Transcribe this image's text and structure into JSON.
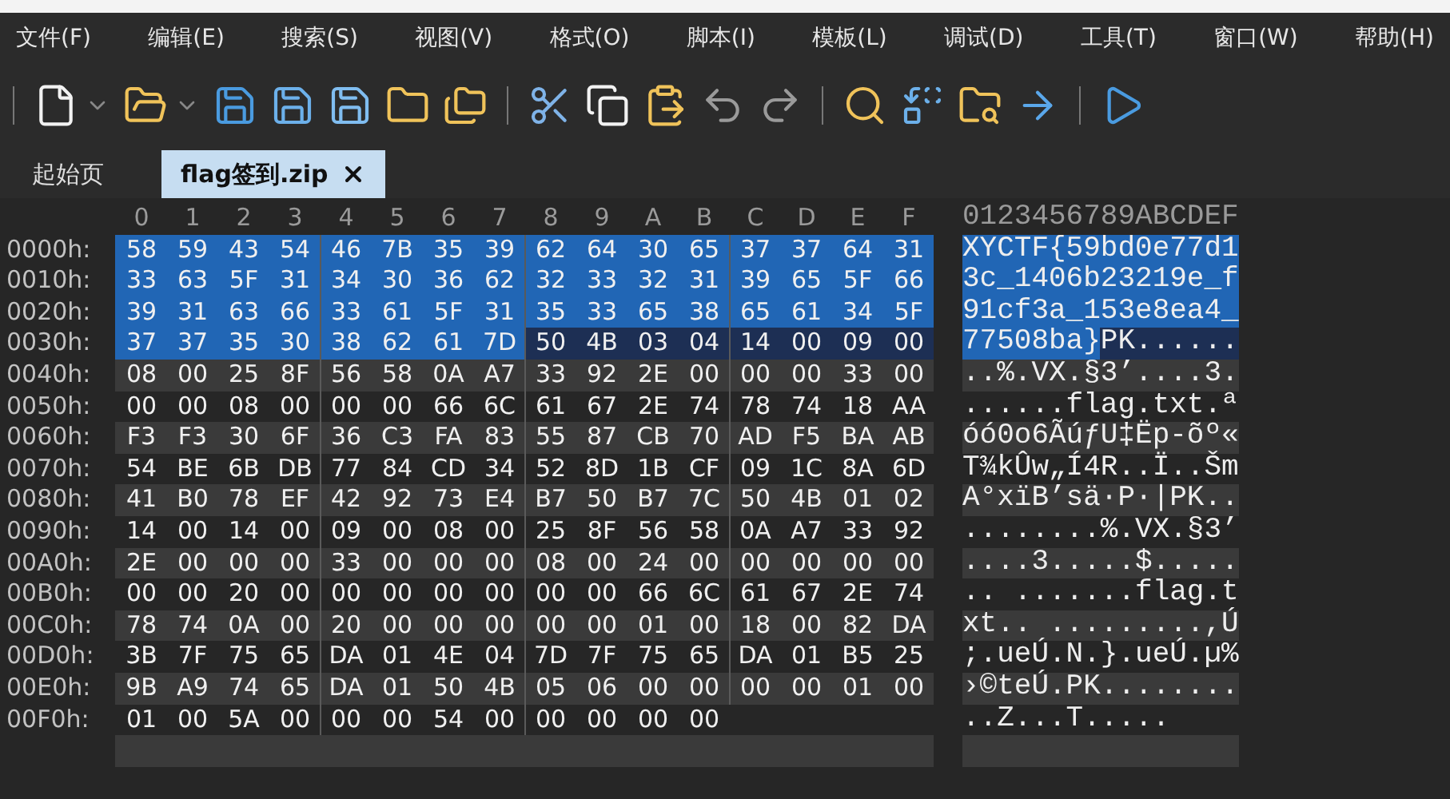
{
  "menu": [
    "文件(F)",
    "编辑(E)",
    "搜索(S)",
    "视图(V)",
    "格式(O)",
    "脚本(I)",
    "模板(L)",
    "调试(D)",
    "工具(T)",
    "窗口(W)",
    "帮助(H)"
  ],
  "tabs": [
    {
      "label": "起始页",
      "selected": false
    },
    {
      "label": "flag签到.zip",
      "selected": true
    }
  ],
  "hex_header": [
    "0",
    "1",
    "2",
    "3",
    "4",
    "5",
    "6",
    "7",
    "8",
    "9",
    "A",
    "B",
    "C",
    "D",
    "E",
    "F"
  ],
  "ascii_header": "0123456789ABCDEF",
  "rows": [
    {
      "offset": "0000h:",
      "bytes": [
        {
          "hex": "58",
          "selected": true,
          "marked": false
        },
        {
          "hex": "59",
          "selected": true,
          "marked": false
        },
        {
          "hex": "43",
          "selected": true,
          "marked": false
        },
        {
          "hex": "54",
          "selected": true,
          "marked": false
        },
        {
          "hex": "46",
          "selected": true,
          "marked": false
        },
        {
          "hex": "7B",
          "selected": true,
          "marked": false
        },
        {
          "hex": "35",
          "selected": true,
          "marked": false
        },
        {
          "hex": "39",
          "selected": true,
          "marked": false
        },
        {
          "hex": "62",
          "selected": true,
          "marked": false
        },
        {
          "hex": "64",
          "selected": true,
          "marked": false
        },
        {
          "hex": "30",
          "selected": true,
          "marked": false
        },
        {
          "hex": "65",
          "selected": true,
          "marked": false
        },
        {
          "hex": "37",
          "selected": true,
          "marked": false
        },
        {
          "hex": "37",
          "selected": true,
          "marked": false
        },
        {
          "hex": "64",
          "selected": true,
          "marked": false
        },
        {
          "hex": "31",
          "selected": true,
          "marked": false
        }
      ],
      "ascii": [
        {
          "text": "XYCTF{59bd0e77d1",
          "selected": true,
          "marked": false
        }
      ]
    },
    {
      "offset": "0010h:",
      "bytes": [
        {
          "hex": "33",
          "selected": true,
          "marked": false
        },
        {
          "hex": "63",
          "selected": true,
          "marked": false
        },
        {
          "hex": "5F",
          "selected": true,
          "marked": false
        },
        {
          "hex": "31",
          "selected": true,
          "marked": false
        },
        {
          "hex": "34",
          "selected": true,
          "marked": false
        },
        {
          "hex": "30",
          "selected": true,
          "marked": false
        },
        {
          "hex": "36",
          "selected": true,
          "marked": false
        },
        {
          "hex": "62",
          "selected": true,
          "marked": false
        },
        {
          "hex": "32",
          "selected": true,
          "marked": false
        },
        {
          "hex": "33",
          "selected": true,
          "marked": false
        },
        {
          "hex": "32",
          "selected": true,
          "marked": false
        },
        {
          "hex": "31",
          "selected": true,
          "marked": false
        },
        {
          "hex": "39",
          "selected": true,
          "marked": false
        },
        {
          "hex": "65",
          "selected": true,
          "marked": false
        },
        {
          "hex": "5F",
          "selected": true,
          "marked": false
        },
        {
          "hex": "66",
          "selected": true,
          "marked": false
        }
      ],
      "ascii": [
        {
          "text": "3c_1406b23219e_f",
          "selected": true,
          "marked": false
        }
      ]
    },
    {
      "offset": "0020h:",
      "bytes": [
        {
          "hex": "39",
          "selected": true,
          "marked": false
        },
        {
          "hex": "31",
          "selected": true,
          "marked": false
        },
        {
          "hex": "63",
          "selected": true,
          "marked": false
        },
        {
          "hex": "66",
          "selected": true,
          "marked": false
        },
        {
          "hex": "33",
          "selected": true,
          "marked": false
        },
        {
          "hex": "61",
          "selected": true,
          "marked": false
        },
        {
          "hex": "5F",
          "selected": true,
          "marked": false
        },
        {
          "hex": "31",
          "selected": true,
          "marked": false
        },
        {
          "hex": "35",
          "selected": true,
          "marked": false
        },
        {
          "hex": "33",
          "selected": true,
          "marked": false
        },
        {
          "hex": "65",
          "selected": true,
          "marked": false
        },
        {
          "hex": "38",
          "selected": true,
          "marked": false
        },
        {
          "hex": "65",
          "selected": true,
          "marked": false
        },
        {
          "hex": "61",
          "selected": true,
          "marked": false
        },
        {
          "hex": "34",
          "selected": true,
          "marked": false
        },
        {
          "hex": "5F",
          "selected": true,
          "marked": false
        }
      ],
      "ascii": [
        {
          "text": "91cf3a_153e8ea4_",
          "selected": true,
          "marked": false
        }
      ]
    },
    {
      "offset": "0030h:",
      "bytes": [
        {
          "hex": "37",
          "selected": true,
          "marked": false
        },
        {
          "hex": "37",
          "selected": true,
          "marked": false
        },
        {
          "hex": "35",
          "selected": true,
          "marked": false
        },
        {
          "hex": "30",
          "selected": true,
          "marked": false
        },
        {
          "hex": "38",
          "selected": true,
          "marked": false
        },
        {
          "hex": "62",
          "selected": true,
          "marked": false
        },
        {
          "hex": "61",
          "selected": true,
          "marked": false
        },
        {
          "hex": "7D",
          "selected": true,
          "marked": false
        },
        {
          "hex": "50",
          "selected": false,
          "marked": true
        },
        {
          "hex": "4B",
          "selected": false,
          "marked": true
        },
        {
          "hex": "03",
          "selected": false,
          "marked": true
        },
        {
          "hex": "04",
          "selected": false,
          "marked": true
        },
        {
          "hex": "14",
          "selected": false,
          "marked": true
        },
        {
          "hex": "00",
          "selected": false,
          "marked": true
        },
        {
          "hex": "09",
          "selected": false,
          "marked": true
        },
        {
          "hex": "00",
          "selected": false,
          "marked": true
        }
      ],
      "ascii": [
        {
          "text": "77508ba}",
          "selected": true,
          "marked": false
        },
        {
          "text": "PK......",
          "selected": false,
          "marked": true
        }
      ]
    },
    {
      "offset": "0040h:",
      "bytes": [
        {
          "hex": "08",
          "selected": false,
          "marked": false
        },
        {
          "hex": "00",
          "selected": false,
          "marked": false
        },
        {
          "hex": "25",
          "selected": false,
          "marked": false
        },
        {
          "hex": "8F",
          "selected": false,
          "marked": false
        },
        {
          "hex": "56",
          "selected": false,
          "marked": false
        },
        {
          "hex": "58",
          "selected": false,
          "marked": false
        },
        {
          "hex": "0A",
          "selected": false,
          "marked": false
        },
        {
          "hex": "A7",
          "selected": false,
          "marked": false
        },
        {
          "hex": "33",
          "selected": false,
          "marked": false
        },
        {
          "hex": "92",
          "selected": false,
          "marked": false
        },
        {
          "hex": "2E",
          "selected": false,
          "marked": false
        },
        {
          "hex": "00",
          "selected": false,
          "marked": false
        },
        {
          "hex": "00",
          "selected": false,
          "marked": false
        },
        {
          "hex": "00",
          "selected": false,
          "marked": false
        },
        {
          "hex": "33",
          "selected": false,
          "marked": false
        },
        {
          "hex": "00",
          "selected": false,
          "marked": false
        }
      ],
      "ascii": [
        {
          "text": "..%.VX.§3’....3.",
          "selected": false,
          "marked": false
        }
      ]
    },
    {
      "offset": "0050h:",
      "bytes": [
        {
          "hex": "00",
          "selected": false,
          "marked": false
        },
        {
          "hex": "00",
          "selected": false,
          "marked": false
        },
        {
          "hex": "08",
          "selected": false,
          "marked": false
        },
        {
          "hex": "00",
          "selected": false,
          "marked": false
        },
        {
          "hex": "00",
          "selected": false,
          "marked": false
        },
        {
          "hex": "00",
          "selected": false,
          "marked": false
        },
        {
          "hex": "66",
          "selected": false,
          "marked": false
        },
        {
          "hex": "6C",
          "selected": false,
          "marked": false
        },
        {
          "hex": "61",
          "selected": false,
          "marked": false
        },
        {
          "hex": "67",
          "selected": false,
          "marked": false
        },
        {
          "hex": "2E",
          "selected": false,
          "marked": false
        },
        {
          "hex": "74",
          "selected": false,
          "marked": false
        },
        {
          "hex": "78",
          "selected": false,
          "marked": false
        },
        {
          "hex": "74",
          "selected": false,
          "marked": false
        },
        {
          "hex": "18",
          "selected": false,
          "marked": false
        },
        {
          "hex": "AA",
          "selected": false,
          "marked": false
        }
      ],
      "ascii": [
        {
          "text": "......flag.txt.ª",
          "selected": false,
          "marked": false
        }
      ]
    },
    {
      "offset": "0060h:",
      "bytes": [
        {
          "hex": "F3",
          "selected": false,
          "marked": false
        },
        {
          "hex": "F3",
          "selected": false,
          "marked": false
        },
        {
          "hex": "30",
          "selected": false,
          "marked": false
        },
        {
          "hex": "6F",
          "selected": false,
          "marked": false
        },
        {
          "hex": "36",
          "selected": false,
          "marked": false
        },
        {
          "hex": "C3",
          "selected": false,
          "marked": false
        },
        {
          "hex": "FA",
          "selected": false,
          "marked": false
        },
        {
          "hex": "83",
          "selected": false,
          "marked": false
        },
        {
          "hex": "55",
          "selected": false,
          "marked": false
        },
        {
          "hex": "87",
          "selected": false,
          "marked": false
        },
        {
          "hex": "CB",
          "selected": false,
          "marked": false
        },
        {
          "hex": "70",
          "selected": false,
          "marked": false
        },
        {
          "hex": "AD",
          "selected": false,
          "marked": false
        },
        {
          "hex": "F5",
          "selected": false,
          "marked": false
        },
        {
          "hex": "BA",
          "selected": false,
          "marked": false
        },
        {
          "hex": "AB",
          "selected": false,
          "marked": false
        }
      ],
      "ascii": [
        {
          "text": "óó0o6ÃúƒU‡Ëp-õº«",
          "selected": false,
          "marked": false
        }
      ]
    },
    {
      "offset": "0070h:",
      "bytes": [
        {
          "hex": "54",
          "selected": false,
          "marked": false
        },
        {
          "hex": "BE",
          "selected": false,
          "marked": false
        },
        {
          "hex": "6B",
          "selected": false,
          "marked": false
        },
        {
          "hex": "DB",
          "selected": false,
          "marked": false
        },
        {
          "hex": "77",
          "selected": false,
          "marked": false
        },
        {
          "hex": "84",
          "selected": false,
          "marked": false
        },
        {
          "hex": "CD",
          "selected": false,
          "marked": false
        },
        {
          "hex": "34",
          "selected": false,
          "marked": false
        },
        {
          "hex": "52",
          "selected": false,
          "marked": false
        },
        {
          "hex": "8D",
          "selected": false,
          "marked": false
        },
        {
          "hex": "1B",
          "selected": false,
          "marked": false
        },
        {
          "hex": "CF",
          "selected": false,
          "marked": false
        },
        {
          "hex": "09",
          "selected": false,
          "marked": false
        },
        {
          "hex": "1C",
          "selected": false,
          "marked": false
        },
        {
          "hex": "8A",
          "selected": false,
          "marked": false
        },
        {
          "hex": "6D",
          "selected": false,
          "marked": false
        }
      ],
      "ascii": [
        {
          "text": "T¾kÛw„Í4R..Ï..Šm",
          "selected": false,
          "marked": false
        }
      ]
    },
    {
      "offset": "0080h:",
      "bytes": [
        {
          "hex": "41",
          "selected": false,
          "marked": false
        },
        {
          "hex": "B0",
          "selected": false,
          "marked": false
        },
        {
          "hex": "78",
          "selected": false,
          "marked": false
        },
        {
          "hex": "EF",
          "selected": false,
          "marked": false
        },
        {
          "hex": "42",
          "selected": false,
          "marked": false
        },
        {
          "hex": "92",
          "selected": false,
          "marked": false
        },
        {
          "hex": "73",
          "selected": false,
          "marked": false
        },
        {
          "hex": "E4",
          "selected": false,
          "marked": false
        },
        {
          "hex": "B7",
          "selected": false,
          "marked": false
        },
        {
          "hex": "50",
          "selected": false,
          "marked": false
        },
        {
          "hex": "B7",
          "selected": false,
          "marked": false
        },
        {
          "hex": "7C",
          "selected": false,
          "marked": false
        },
        {
          "hex": "50",
          "selected": false,
          "marked": false
        },
        {
          "hex": "4B",
          "selected": false,
          "marked": false
        },
        {
          "hex": "01",
          "selected": false,
          "marked": false
        },
        {
          "hex": "02",
          "selected": false,
          "marked": false
        }
      ],
      "ascii": [
        {
          "text": "A°xïB’sä·P·|PK..",
          "selected": false,
          "marked": false
        }
      ]
    },
    {
      "offset": "0090h:",
      "bytes": [
        {
          "hex": "14",
          "selected": false,
          "marked": false
        },
        {
          "hex": "00",
          "selected": false,
          "marked": false
        },
        {
          "hex": "14",
          "selected": false,
          "marked": false
        },
        {
          "hex": "00",
          "selected": false,
          "marked": false
        },
        {
          "hex": "09",
          "selected": false,
          "marked": false
        },
        {
          "hex": "00",
          "selected": false,
          "marked": false
        },
        {
          "hex": "08",
          "selected": false,
          "marked": false
        },
        {
          "hex": "00",
          "selected": false,
          "marked": false
        },
        {
          "hex": "25",
          "selected": false,
          "marked": false
        },
        {
          "hex": "8F",
          "selected": false,
          "marked": false
        },
        {
          "hex": "56",
          "selected": false,
          "marked": false
        },
        {
          "hex": "58",
          "selected": false,
          "marked": false
        },
        {
          "hex": "0A",
          "selected": false,
          "marked": false
        },
        {
          "hex": "A7",
          "selected": false,
          "marked": false
        },
        {
          "hex": "33",
          "selected": false,
          "marked": false
        },
        {
          "hex": "92",
          "selected": false,
          "marked": false
        }
      ],
      "ascii": [
        {
          "text": "........%.VX.§3’",
          "selected": false,
          "marked": false
        }
      ]
    },
    {
      "offset": "00A0h:",
      "bytes": [
        {
          "hex": "2E",
          "selected": false,
          "marked": false
        },
        {
          "hex": "00",
          "selected": false,
          "marked": false
        },
        {
          "hex": "00",
          "selected": false,
          "marked": false
        },
        {
          "hex": "00",
          "selected": false,
          "marked": false
        },
        {
          "hex": "33",
          "selected": false,
          "marked": false
        },
        {
          "hex": "00",
          "selected": false,
          "marked": false
        },
        {
          "hex": "00",
          "selected": false,
          "marked": false
        },
        {
          "hex": "00",
          "selected": false,
          "marked": false
        },
        {
          "hex": "08",
          "selected": false,
          "marked": false
        },
        {
          "hex": "00",
          "selected": false,
          "marked": false
        },
        {
          "hex": "24",
          "selected": false,
          "marked": false
        },
        {
          "hex": "00",
          "selected": false,
          "marked": false
        },
        {
          "hex": "00",
          "selected": false,
          "marked": false
        },
        {
          "hex": "00",
          "selected": false,
          "marked": false
        },
        {
          "hex": "00",
          "selected": false,
          "marked": false
        },
        {
          "hex": "00",
          "selected": false,
          "marked": false
        }
      ],
      "ascii": [
        {
          "text": "....3.....$.....",
          "selected": false,
          "marked": false
        }
      ]
    },
    {
      "offset": "00B0h:",
      "bytes": [
        {
          "hex": "00",
          "selected": false,
          "marked": false
        },
        {
          "hex": "00",
          "selected": false,
          "marked": false
        },
        {
          "hex": "20",
          "selected": false,
          "marked": false
        },
        {
          "hex": "00",
          "selected": false,
          "marked": false
        },
        {
          "hex": "00",
          "selected": false,
          "marked": false
        },
        {
          "hex": "00",
          "selected": false,
          "marked": false
        },
        {
          "hex": "00",
          "selected": false,
          "marked": false
        },
        {
          "hex": "00",
          "selected": false,
          "marked": false
        },
        {
          "hex": "00",
          "selected": false,
          "marked": false
        },
        {
          "hex": "00",
          "selected": false,
          "marked": false
        },
        {
          "hex": "66",
          "selected": false,
          "marked": false
        },
        {
          "hex": "6C",
          "selected": false,
          "marked": false
        },
        {
          "hex": "61",
          "selected": false,
          "marked": false
        },
        {
          "hex": "67",
          "selected": false,
          "marked": false
        },
        {
          "hex": "2E",
          "selected": false,
          "marked": false
        },
        {
          "hex": "74",
          "selected": false,
          "marked": false
        }
      ],
      "ascii": [
        {
          "text": ".. .......flag.t",
          "selected": false,
          "marked": false
        }
      ]
    },
    {
      "offset": "00C0h:",
      "bytes": [
        {
          "hex": "78",
          "selected": false,
          "marked": false
        },
        {
          "hex": "74",
          "selected": false,
          "marked": false
        },
        {
          "hex": "0A",
          "selected": false,
          "marked": false
        },
        {
          "hex": "00",
          "selected": false,
          "marked": false
        },
        {
          "hex": "20",
          "selected": false,
          "marked": false
        },
        {
          "hex": "00",
          "selected": false,
          "marked": false
        },
        {
          "hex": "00",
          "selected": false,
          "marked": false
        },
        {
          "hex": "00",
          "selected": false,
          "marked": false
        },
        {
          "hex": "00",
          "selected": false,
          "marked": false
        },
        {
          "hex": "00",
          "selected": false,
          "marked": false
        },
        {
          "hex": "01",
          "selected": false,
          "marked": false
        },
        {
          "hex": "00",
          "selected": false,
          "marked": false
        },
        {
          "hex": "18",
          "selected": false,
          "marked": false
        },
        {
          "hex": "00",
          "selected": false,
          "marked": false
        },
        {
          "hex": "82",
          "selected": false,
          "marked": false
        },
        {
          "hex": "DA",
          "selected": false,
          "marked": false
        }
      ],
      "ascii": [
        {
          "text": "xt.. .........,Ú",
          "selected": false,
          "marked": false
        }
      ]
    },
    {
      "offset": "00D0h:",
      "bytes": [
        {
          "hex": "3B",
          "selected": false,
          "marked": false
        },
        {
          "hex": "7F",
          "selected": false,
          "marked": false
        },
        {
          "hex": "75",
          "selected": false,
          "marked": false
        },
        {
          "hex": "65",
          "selected": false,
          "marked": false
        },
        {
          "hex": "DA",
          "selected": false,
          "marked": false
        },
        {
          "hex": "01",
          "selected": false,
          "marked": false
        },
        {
          "hex": "4E",
          "selected": false,
          "marked": false
        },
        {
          "hex": "04",
          "selected": false,
          "marked": false
        },
        {
          "hex": "7D",
          "selected": false,
          "marked": false
        },
        {
          "hex": "7F",
          "selected": false,
          "marked": false
        },
        {
          "hex": "75",
          "selected": false,
          "marked": false
        },
        {
          "hex": "65",
          "selected": false,
          "marked": false
        },
        {
          "hex": "DA",
          "selected": false,
          "marked": false
        },
        {
          "hex": "01",
          "selected": false,
          "marked": false
        },
        {
          "hex": "B5",
          "selected": false,
          "marked": false
        },
        {
          "hex": "25",
          "selected": false,
          "marked": false
        }
      ],
      "ascii": [
        {
          "text": ";.ueÚ.N.}.ueÚ.µ%",
          "selected": false,
          "marked": false
        }
      ]
    },
    {
      "offset": "00E0h:",
      "bytes": [
        {
          "hex": "9B",
          "selected": false,
          "marked": false
        },
        {
          "hex": "A9",
          "selected": false,
          "marked": false
        },
        {
          "hex": "74",
          "selected": false,
          "marked": false
        },
        {
          "hex": "65",
          "selected": false,
          "marked": false
        },
        {
          "hex": "DA",
          "selected": false,
          "marked": false
        },
        {
          "hex": "01",
          "selected": false,
          "marked": false
        },
        {
          "hex": "50",
          "selected": false,
          "marked": false
        },
        {
          "hex": "4B",
          "selected": false,
          "marked": false
        },
        {
          "hex": "05",
          "selected": false,
          "marked": false
        },
        {
          "hex": "06",
          "selected": false,
          "marked": false
        },
        {
          "hex": "00",
          "selected": false,
          "marked": false
        },
        {
          "hex": "00",
          "selected": false,
          "marked": false
        },
        {
          "hex": "00",
          "selected": false,
          "marked": false
        },
        {
          "hex": "00",
          "selected": false,
          "marked": false
        },
        {
          "hex": "01",
          "selected": false,
          "marked": false
        },
        {
          "hex": "00",
          "selected": false,
          "marked": false
        }
      ],
      "ascii": [
        {
          "text": "›©teÚ.PK........",
          "selected": false,
          "marked": false
        }
      ]
    },
    {
      "offset": "00F0h:",
      "bytes": [
        {
          "hex": "01",
          "selected": false,
          "marked": false
        },
        {
          "hex": "00",
          "selected": false,
          "marked": false
        },
        {
          "hex": "5A",
          "selected": false,
          "marked": false
        },
        {
          "hex": "00",
          "selected": false,
          "marked": false
        },
        {
          "hex": "00",
          "selected": false,
          "marked": false
        },
        {
          "hex": "00",
          "selected": false,
          "marked": false
        },
        {
          "hex": "54",
          "selected": false,
          "marked": false
        },
        {
          "hex": "00",
          "selected": false,
          "marked": false
        },
        {
          "hex": "00",
          "selected": false,
          "marked": false
        },
        {
          "hex": "00",
          "selected": false,
          "marked": false
        },
        {
          "hex": "00",
          "selected": false,
          "marked": false
        },
        {
          "hex": "00",
          "selected": false,
          "marked": false
        }
      ],
      "ascii": [
        {
          "text": "..Z...T.....",
          "selected": false,
          "marked": false
        }
      ]
    }
  ]
}
